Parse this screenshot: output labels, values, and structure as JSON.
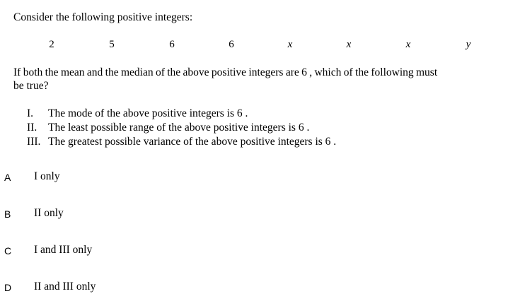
{
  "question": {
    "intro": "Consider the following positive integers:",
    "numbers": [
      "2",
      "5",
      "6",
      "6",
      "x",
      "x",
      "x",
      "y"
    ],
    "prompt_line1": "If both the mean and the median of the above positive integers are  6 ,  which of the following must",
    "prompt_line2": "be true?",
    "statements": [
      {
        "numeral": "I.",
        "text": "The mode of the above positive integers is  6 ."
      },
      {
        "numeral": "II.",
        "text": "The least possible range of the above positive integers is  6 ."
      },
      {
        "numeral": "III.",
        "text": "The greatest possible variance of the above positive integers is  6 ."
      }
    ]
  },
  "choices": [
    {
      "letter": "A",
      "text": "I only"
    },
    {
      "letter": "B",
      "text": "II only"
    },
    {
      "letter": "C",
      "text": "I and III only"
    },
    {
      "letter": "D",
      "text": "II and III only"
    }
  ]
}
